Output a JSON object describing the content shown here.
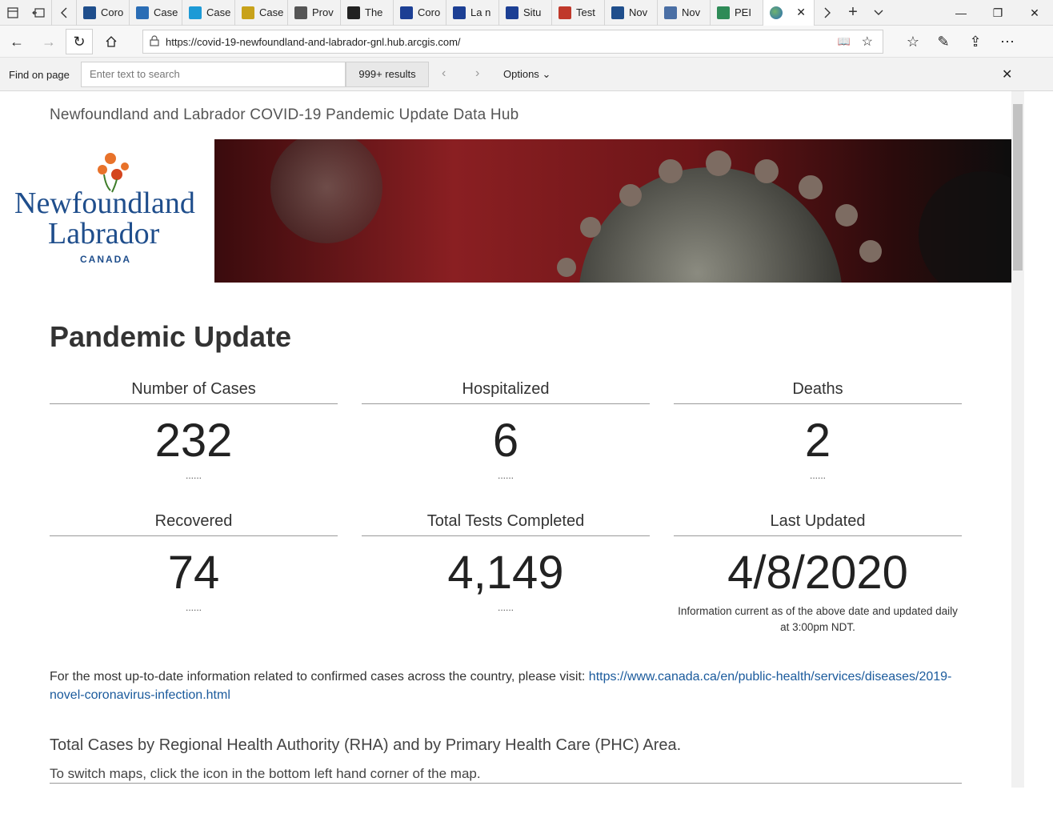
{
  "browser": {
    "tabs": [
      {
        "label": "Coro",
        "fav": "#1f4e8c"
      },
      {
        "label": "Case",
        "fav": "#2a6db5"
      },
      {
        "label": "Case",
        "fav": "#1d9ad6"
      },
      {
        "label": "Case",
        "fav": "#c8a21a"
      },
      {
        "label": "Prov",
        "fav": "#555555"
      },
      {
        "label": "The",
        "fav": "#222222"
      },
      {
        "label": "Coro",
        "fav": "#1c3f94"
      },
      {
        "label": "La n",
        "fav": "#1c3f94"
      },
      {
        "label": "Situ",
        "fav": "#1c3f94"
      },
      {
        "label": "Test",
        "fav": "#c0392b"
      },
      {
        "label": "Nov",
        "fav": "#1f4e8c"
      },
      {
        "label": "Nov",
        "fav": "#4a6fa5"
      },
      {
        "label": "PEI",
        "fav": "#2e8b57"
      }
    ],
    "url": "https://covid-19-newfoundland-and-labrador-gnl.hub.arcgis.com/",
    "find": {
      "label": "Find on page",
      "placeholder": "Enter text to search",
      "results": "999+ results",
      "options": "Options"
    }
  },
  "page": {
    "hub_title": "Newfoundland and Labrador COVID-19 Pandemic Update Data Hub",
    "logo": {
      "line1": "Newfoundland",
      "line2": "Labrador",
      "line3": "CANADA"
    },
    "heading": "Pandemic Update",
    "stats": [
      {
        "label": "Number of Cases",
        "value": "232",
        "dots": "......"
      },
      {
        "label": "Hospitalized",
        "value": "6",
        "dots": "......"
      },
      {
        "label": "Deaths",
        "value": "2",
        "dots": "......"
      },
      {
        "label": "Recovered",
        "value": "74",
        "dots": "......"
      },
      {
        "label": "Total Tests Completed",
        "value": "4,149",
        "dots": "......"
      },
      {
        "label": "Last Updated",
        "value": "4/8/2020",
        "note": "Information current as of the above date and updated daily at 3:00pm NDT."
      }
    ],
    "info_text": "For the most up-to-date information related to confirmed cases across the country, please visit: ",
    "info_link": "https://www.canada.ca/en/public-health/services/diseases/2019-novel-coronavirus-infection.html",
    "section_title": "Total Cases by Regional Health Authority (RHA) and by Primary Health Care (PHC) Area.",
    "section_note": "To switch maps, click the icon in the bottom left hand corner of the map."
  }
}
